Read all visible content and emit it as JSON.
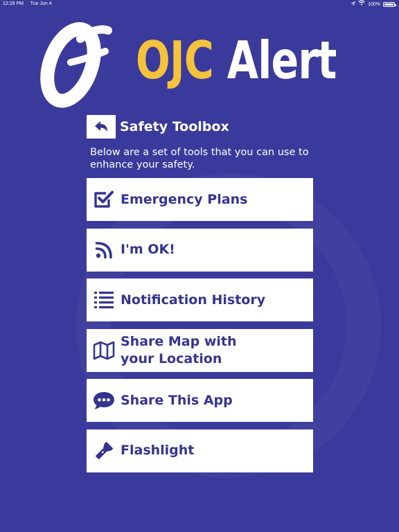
{
  "status_bar": {
    "time": "12:29 PM",
    "date": "Tue Jun 4",
    "battery": "100%"
  },
  "logo": {
    "ojc": "OJC",
    "alert": "Alert"
  },
  "toolbox": {
    "title": "Safety Toolbox",
    "intro": "Below are a set of tools that you can use to enhance your safety."
  },
  "tools": [
    {
      "label": "Emergency Plans",
      "icon": "checkbox-icon"
    },
    {
      "label": "I'm OK!",
      "icon": "rss-icon"
    },
    {
      "label": "Notification History",
      "icon": "list-icon"
    },
    {
      "label": "Share Map with\nyour Location",
      "icon": "map-icon"
    },
    {
      "label": "Share This App",
      "icon": "chat-bubble-icon"
    },
    {
      "label": "Flashlight",
      "icon": "flashlight-icon"
    }
  ],
  "colors": {
    "background": "#3a3a9c",
    "accent_yellow": "#f5c33b",
    "tool_text": "#35358f"
  }
}
